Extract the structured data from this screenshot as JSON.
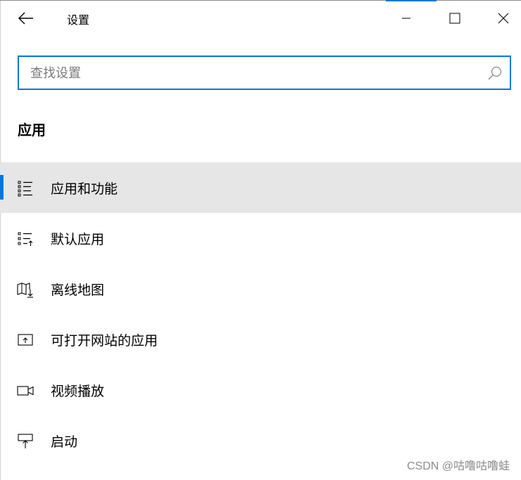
{
  "window": {
    "title": "设置"
  },
  "search": {
    "placeholder": "查找设置",
    "value": ""
  },
  "section": {
    "title": "应用"
  },
  "nav": {
    "items": [
      {
        "label": "应用和功能",
        "icon": "apps-features-icon",
        "selected": true
      },
      {
        "label": "默认应用",
        "icon": "default-apps-icon",
        "selected": false
      },
      {
        "label": "离线地图",
        "icon": "offline-maps-icon",
        "selected": false
      },
      {
        "label": "可打开网站的应用",
        "icon": "apps-for-websites-icon",
        "selected": false
      },
      {
        "label": "视频播放",
        "icon": "video-playback-icon",
        "selected": false
      },
      {
        "label": "启动",
        "icon": "startup-icon",
        "selected": false
      }
    ]
  },
  "watermark": "CSDN @咕噜咕噜蛙",
  "colors": {
    "accent": "#0078d7",
    "selected_bg": "#e6e6e6"
  }
}
